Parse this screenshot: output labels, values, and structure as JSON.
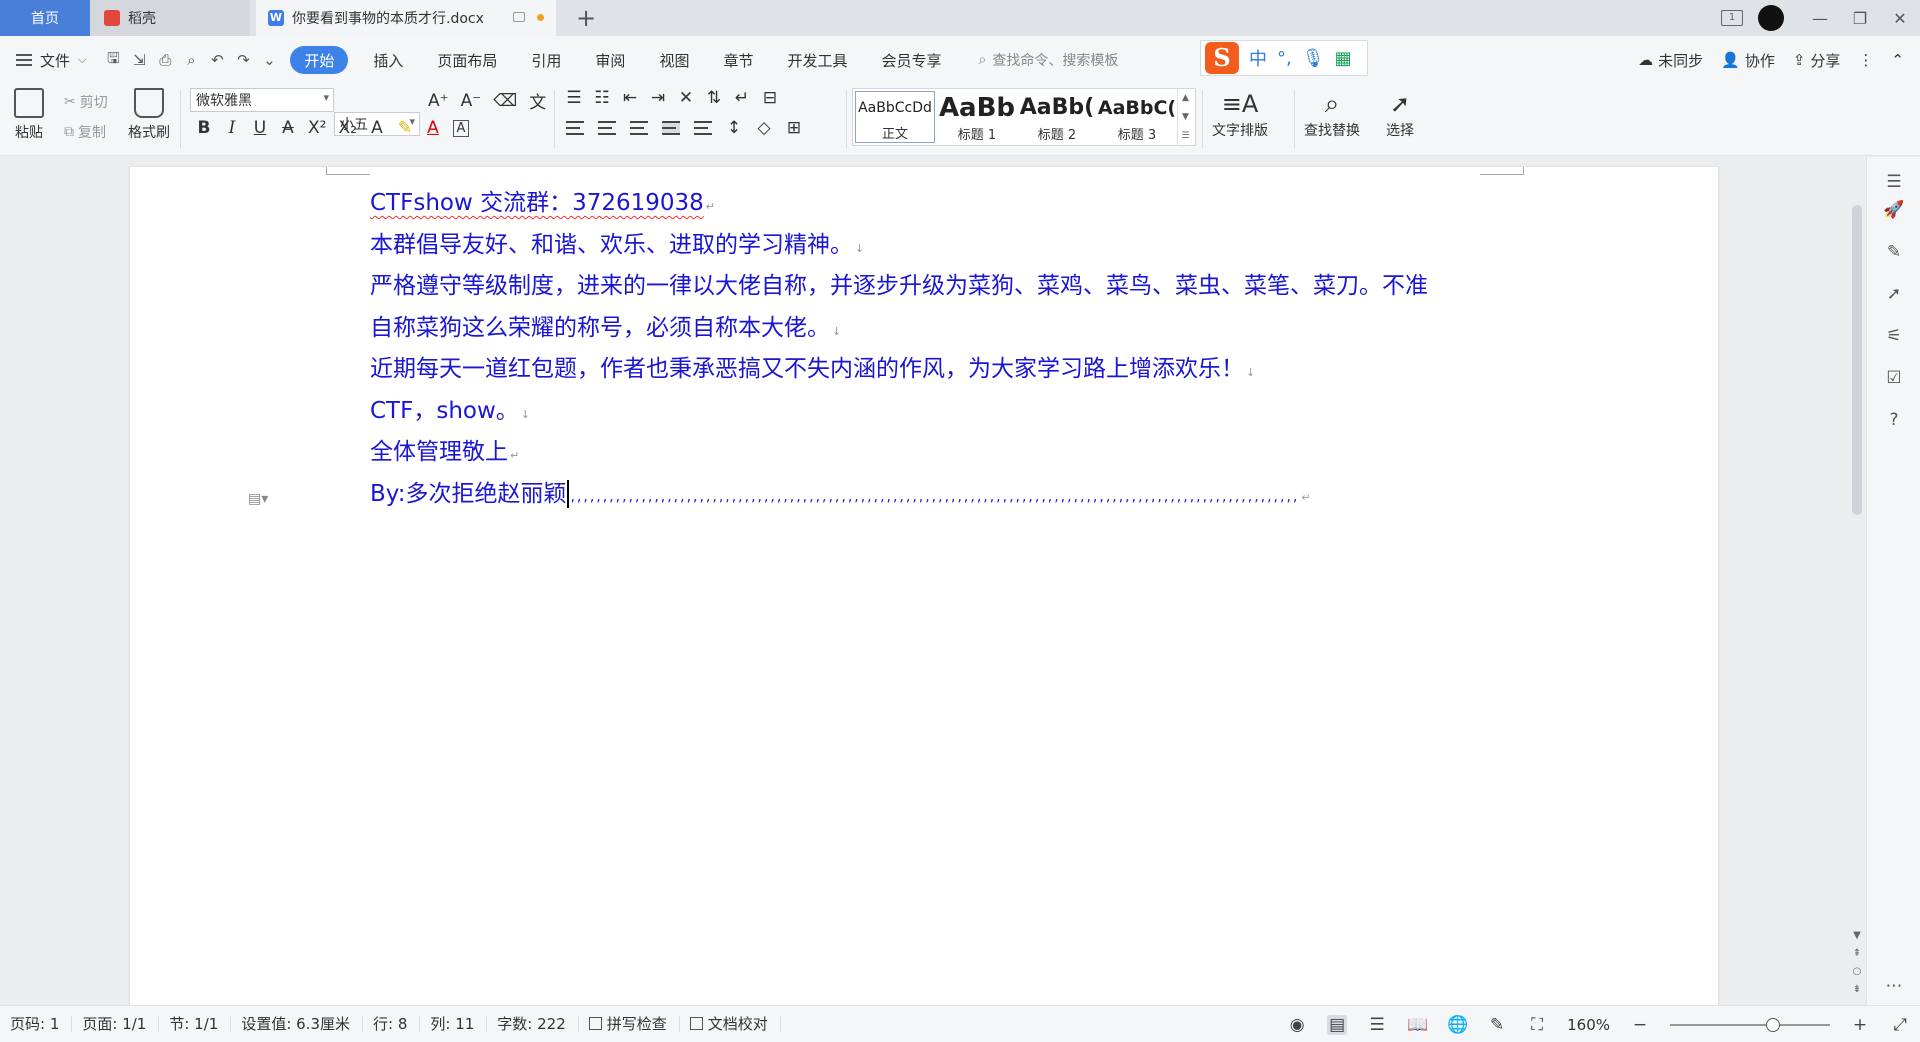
{
  "tabs": {
    "home": "首页",
    "daoke": "稻壳",
    "document": "你要看到事物的本质才行.docx",
    "new_tab": "+"
  },
  "window_controls": {
    "badge": "1"
  },
  "menu": {
    "file": "文件",
    "tabs": [
      "开始",
      "插入",
      "页面布局",
      "引用",
      "审阅",
      "视图",
      "章节",
      "开发工具",
      "会员专享"
    ],
    "search_placeholder": "查找命令、搜索模板"
  },
  "ime": {
    "logo": "S",
    "mode": "中",
    "punct": "°,"
  },
  "right_actions": {
    "sync": "未同步",
    "collab": "协作",
    "share": "分享"
  },
  "toolbar": {
    "paste": "粘贴",
    "cut": "剪切",
    "copy": "复制",
    "format_painter": "格式刷",
    "font_name": "微软雅黑",
    "font_size": "小五",
    "styles": [
      {
        "sample": "AaBbCcDd",
        "name": "正文"
      },
      {
        "sample": "AaBb",
        "name": "标题 1"
      },
      {
        "sample": "AaBb(",
        "name": "标题 2"
      },
      {
        "sample": "AaBbC(",
        "name": "标题 3"
      }
    ],
    "text_layout": "文字排版",
    "find_replace": "查找替换",
    "select": "选择"
  },
  "document": {
    "paragraphs": [
      "CTFshow 交流群：372619038",
      "本群倡导友好、和谐、欢乐、进取的学习精神。",
      "严格遵守等级制度，进来的一律以大佬自称，并逐步升级为菜狗、菜鸡、菜鸟、菜虫、菜笔、菜刀。不准",
      "自称菜狗这么荣耀的称号，必须自称本大佬。",
      "近期每天一道红包题，作者也秉承恶搞又不失内涵的作风，为大家学习路上增添欢乐！",
      "CTF，show。",
      "全体管理敬上",
      "By:多次拒绝赵丽颖"
    ],
    "trailing_marks": ",,,,,,,,,,,,,,,,,,,,,,,,,,,,,,,,,,,,,,,,,,,,,,,,,,,,,,,,,,,,,,,,,,,,,,,,,,,,,,,,,,,,,,,,,,,,,,,,,,,,,,,,,,,,,,,,,"
  },
  "status": {
    "page_num": "页码: 1",
    "pages": "页面: 1/1",
    "section": "节: 1/1",
    "setting": "设置值: 6.3厘米",
    "row": "行: 8",
    "col": "列: 11",
    "chars": "字数: 222",
    "spell_check": "拼写检查",
    "doc_proof": "文档校对",
    "zoom": "160%"
  },
  "colors": {
    "accent": "#3c82e8",
    "doc_text": "#1a16d4",
    "home_tab": "#4a7fd9"
  }
}
